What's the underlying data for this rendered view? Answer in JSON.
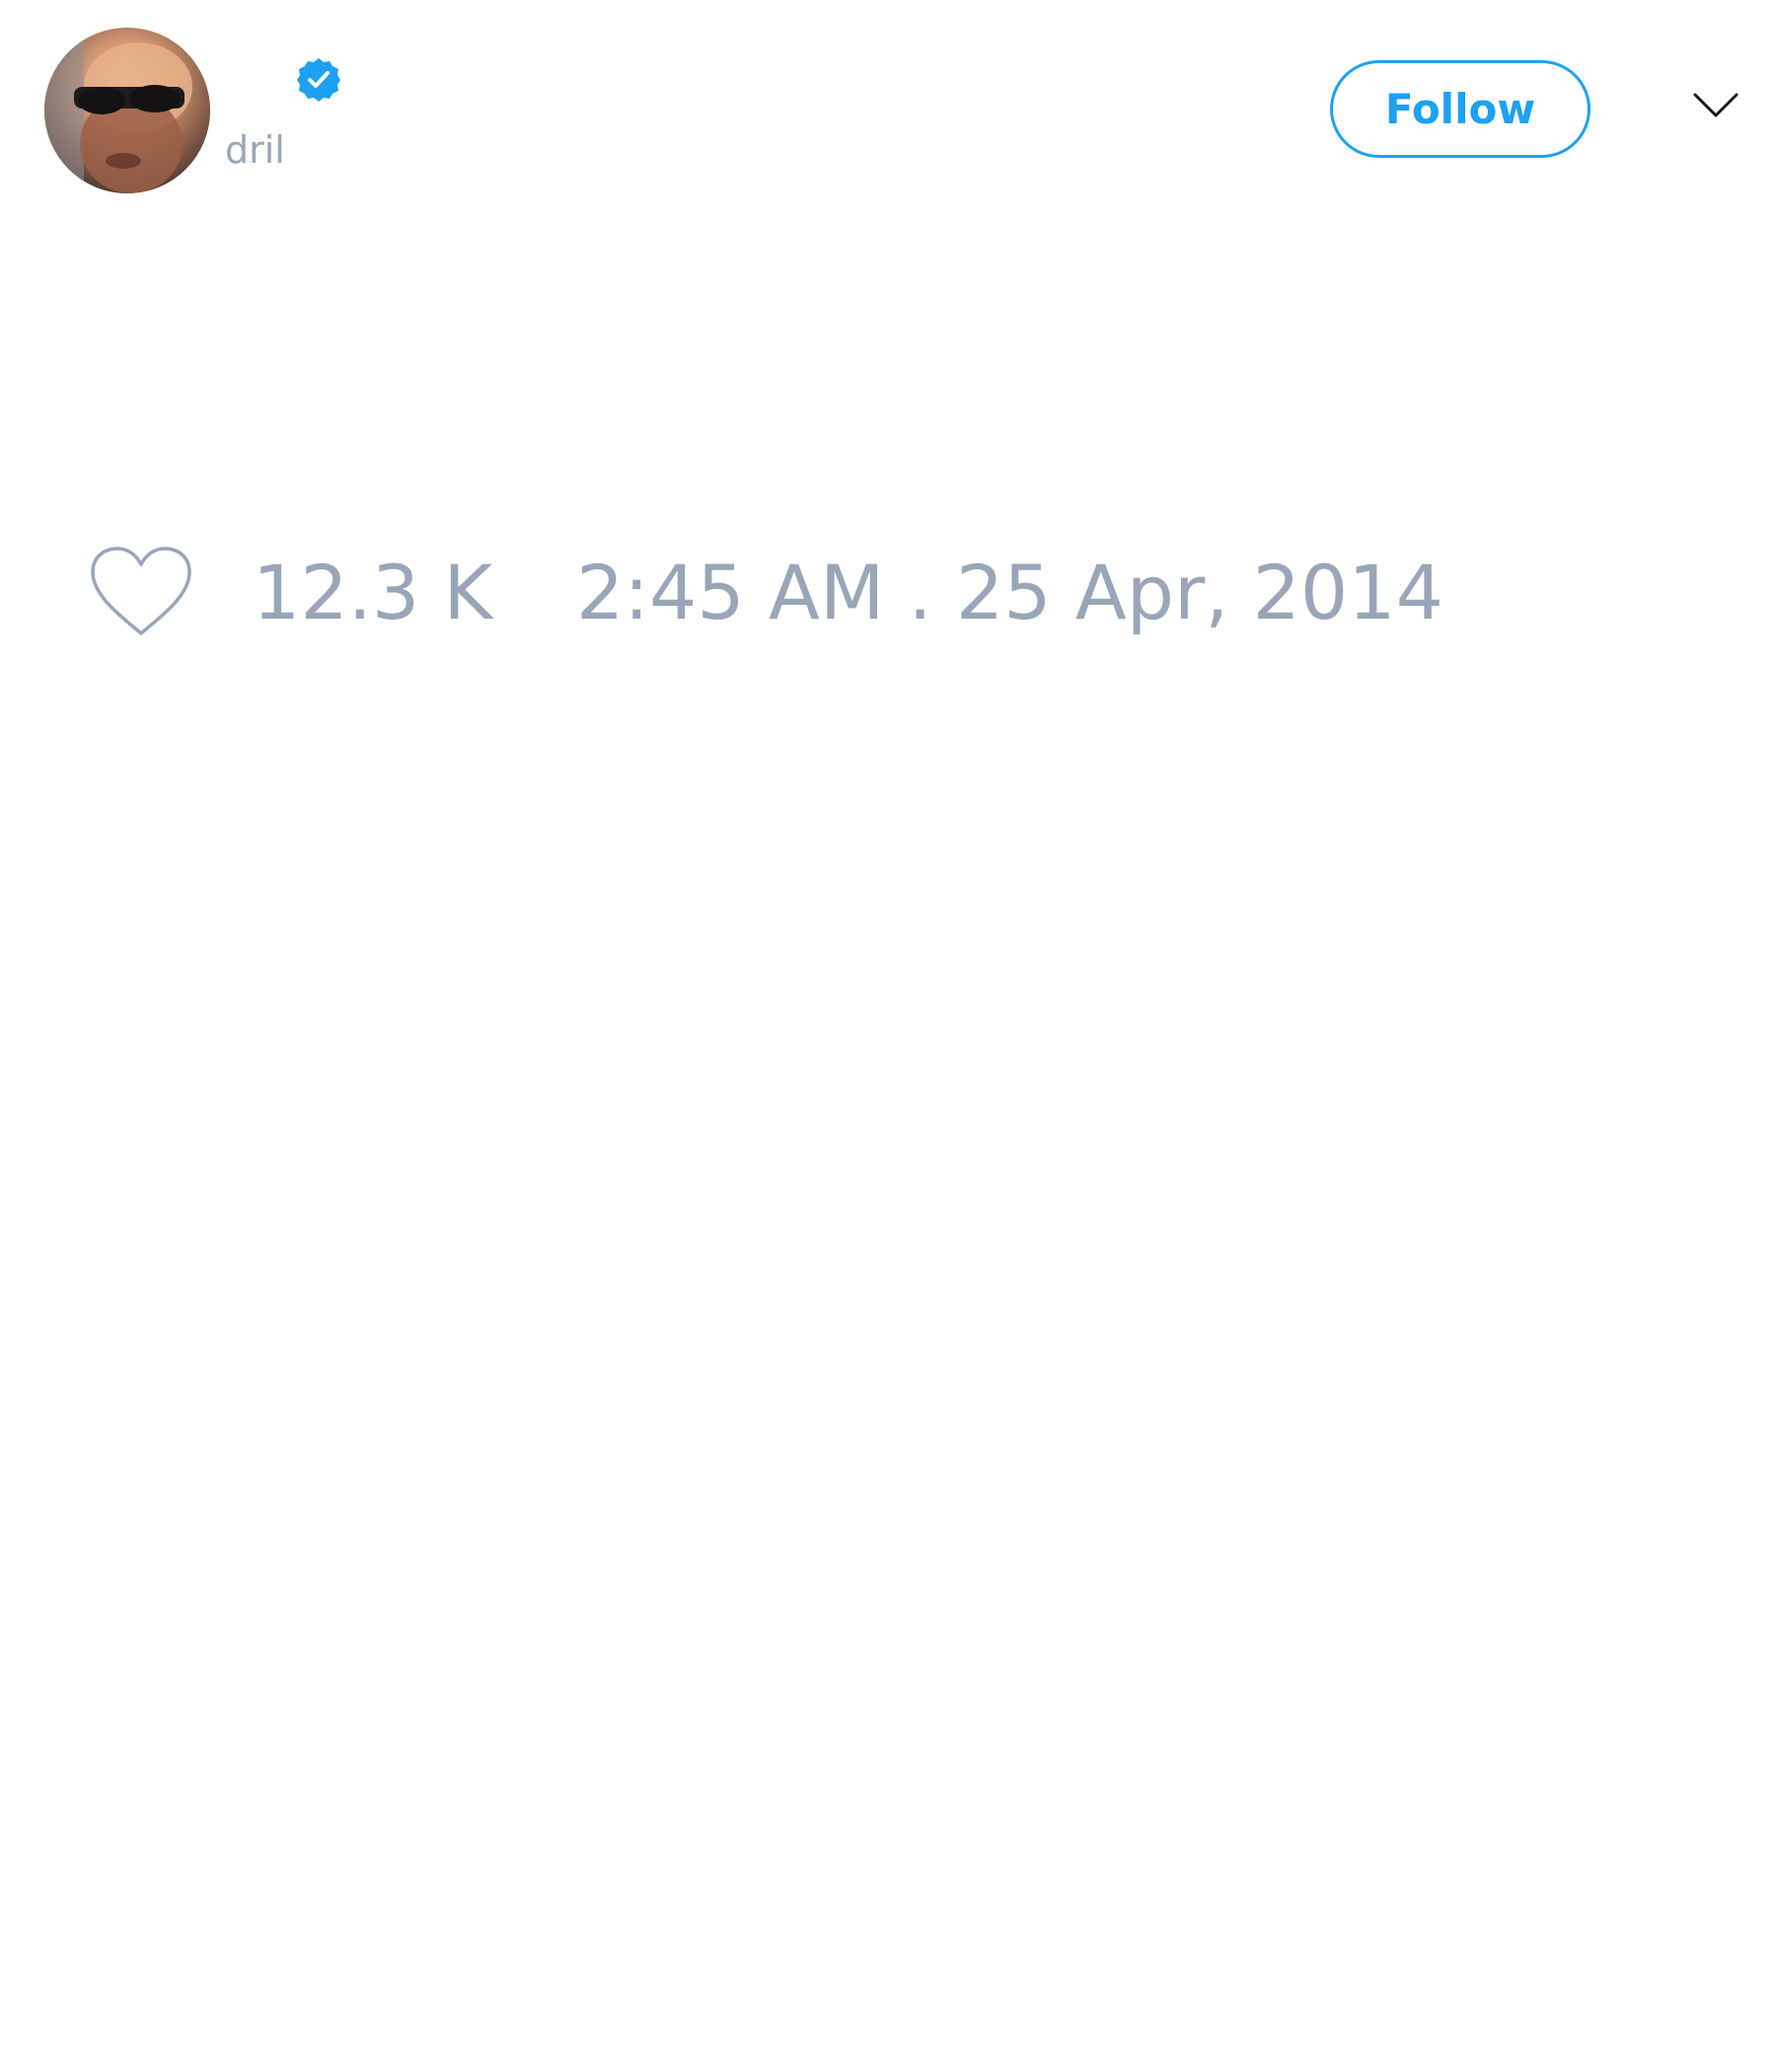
{
  "user": {
    "handle": "dril",
    "verified": true,
    "avatar_icon": "profile-photo"
  },
  "actions": {
    "follow_label": "Follow",
    "menu_icon": "chevron-down-icon"
  },
  "tweet": {
    "like_icon": "heart-icon",
    "like_count": "12.3 K",
    "timestamp": "2:45 AM . 25 Apr, 2014"
  },
  "colors": {
    "accent": "#1da1f2",
    "muted_text": "#99a6b8",
    "background": "#ffffff"
  }
}
